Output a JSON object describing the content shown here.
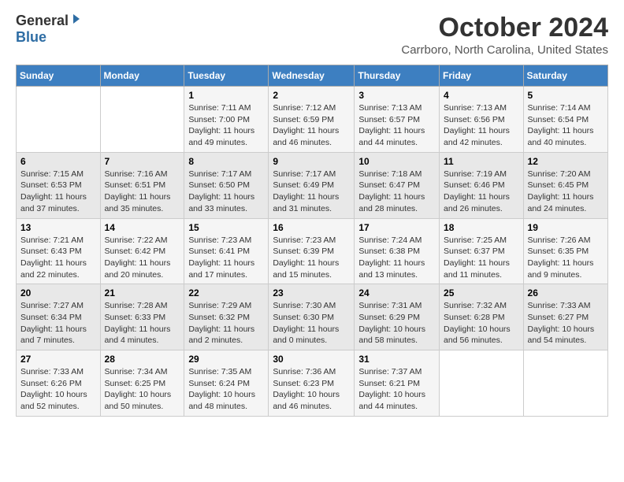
{
  "header": {
    "logo_general": "General",
    "logo_blue": "Blue",
    "main_title": "October 2024",
    "subtitle": "Carrboro, North Carolina, United States"
  },
  "days_of_week": [
    "Sunday",
    "Monday",
    "Tuesday",
    "Wednesday",
    "Thursday",
    "Friday",
    "Saturday"
  ],
  "weeks": [
    [
      {
        "num": "",
        "sunrise": "",
        "sunset": "",
        "daylight": ""
      },
      {
        "num": "",
        "sunrise": "",
        "sunset": "",
        "daylight": ""
      },
      {
        "num": "1",
        "sunrise": "Sunrise: 7:11 AM",
        "sunset": "Sunset: 7:00 PM",
        "daylight": "Daylight: 11 hours and 49 minutes."
      },
      {
        "num": "2",
        "sunrise": "Sunrise: 7:12 AM",
        "sunset": "Sunset: 6:59 PM",
        "daylight": "Daylight: 11 hours and 46 minutes."
      },
      {
        "num": "3",
        "sunrise": "Sunrise: 7:13 AM",
        "sunset": "Sunset: 6:57 PM",
        "daylight": "Daylight: 11 hours and 44 minutes."
      },
      {
        "num": "4",
        "sunrise": "Sunrise: 7:13 AM",
        "sunset": "Sunset: 6:56 PM",
        "daylight": "Daylight: 11 hours and 42 minutes."
      },
      {
        "num": "5",
        "sunrise": "Sunrise: 7:14 AM",
        "sunset": "Sunset: 6:54 PM",
        "daylight": "Daylight: 11 hours and 40 minutes."
      }
    ],
    [
      {
        "num": "6",
        "sunrise": "Sunrise: 7:15 AM",
        "sunset": "Sunset: 6:53 PM",
        "daylight": "Daylight: 11 hours and 37 minutes."
      },
      {
        "num": "7",
        "sunrise": "Sunrise: 7:16 AM",
        "sunset": "Sunset: 6:51 PM",
        "daylight": "Daylight: 11 hours and 35 minutes."
      },
      {
        "num": "8",
        "sunrise": "Sunrise: 7:17 AM",
        "sunset": "Sunset: 6:50 PM",
        "daylight": "Daylight: 11 hours and 33 minutes."
      },
      {
        "num": "9",
        "sunrise": "Sunrise: 7:17 AM",
        "sunset": "Sunset: 6:49 PM",
        "daylight": "Daylight: 11 hours and 31 minutes."
      },
      {
        "num": "10",
        "sunrise": "Sunrise: 7:18 AM",
        "sunset": "Sunset: 6:47 PM",
        "daylight": "Daylight: 11 hours and 28 minutes."
      },
      {
        "num": "11",
        "sunrise": "Sunrise: 7:19 AM",
        "sunset": "Sunset: 6:46 PM",
        "daylight": "Daylight: 11 hours and 26 minutes."
      },
      {
        "num": "12",
        "sunrise": "Sunrise: 7:20 AM",
        "sunset": "Sunset: 6:45 PM",
        "daylight": "Daylight: 11 hours and 24 minutes."
      }
    ],
    [
      {
        "num": "13",
        "sunrise": "Sunrise: 7:21 AM",
        "sunset": "Sunset: 6:43 PM",
        "daylight": "Daylight: 11 hours and 22 minutes."
      },
      {
        "num": "14",
        "sunrise": "Sunrise: 7:22 AM",
        "sunset": "Sunset: 6:42 PM",
        "daylight": "Daylight: 11 hours and 20 minutes."
      },
      {
        "num": "15",
        "sunrise": "Sunrise: 7:23 AM",
        "sunset": "Sunset: 6:41 PM",
        "daylight": "Daylight: 11 hours and 17 minutes."
      },
      {
        "num": "16",
        "sunrise": "Sunrise: 7:23 AM",
        "sunset": "Sunset: 6:39 PM",
        "daylight": "Daylight: 11 hours and 15 minutes."
      },
      {
        "num": "17",
        "sunrise": "Sunrise: 7:24 AM",
        "sunset": "Sunset: 6:38 PM",
        "daylight": "Daylight: 11 hours and 13 minutes."
      },
      {
        "num": "18",
        "sunrise": "Sunrise: 7:25 AM",
        "sunset": "Sunset: 6:37 PM",
        "daylight": "Daylight: 11 hours and 11 minutes."
      },
      {
        "num": "19",
        "sunrise": "Sunrise: 7:26 AM",
        "sunset": "Sunset: 6:35 PM",
        "daylight": "Daylight: 11 hours and 9 minutes."
      }
    ],
    [
      {
        "num": "20",
        "sunrise": "Sunrise: 7:27 AM",
        "sunset": "Sunset: 6:34 PM",
        "daylight": "Daylight: 11 hours and 7 minutes."
      },
      {
        "num": "21",
        "sunrise": "Sunrise: 7:28 AM",
        "sunset": "Sunset: 6:33 PM",
        "daylight": "Daylight: 11 hours and 4 minutes."
      },
      {
        "num": "22",
        "sunrise": "Sunrise: 7:29 AM",
        "sunset": "Sunset: 6:32 PM",
        "daylight": "Daylight: 11 hours and 2 minutes."
      },
      {
        "num": "23",
        "sunrise": "Sunrise: 7:30 AM",
        "sunset": "Sunset: 6:30 PM",
        "daylight": "Daylight: 11 hours and 0 minutes."
      },
      {
        "num": "24",
        "sunrise": "Sunrise: 7:31 AM",
        "sunset": "Sunset: 6:29 PM",
        "daylight": "Daylight: 10 hours and 58 minutes."
      },
      {
        "num": "25",
        "sunrise": "Sunrise: 7:32 AM",
        "sunset": "Sunset: 6:28 PM",
        "daylight": "Daylight: 10 hours and 56 minutes."
      },
      {
        "num": "26",
        "sunrise": "Sunrise: 7:33 AM",
        "sunset": "Sunset: 6:27 PM",
        "daylight": "Daylight: 10 hours and 54 minutes."
      }
    ],
    [
      {
        "num": "27",
        "sunrise": "Sunrise: 7:33 AM",
        "sunset": "Sunset: 6:26 PM",
        "daylight": "Daylight: 10 hours and 52 minutes."
      },
      {
        "num": "28",
        "sunrise": "Sunrise: 7:34 AM",
        "sunset": "Sunset: 6:25 PM",
        "daylight": "Daylight: 10 hours and 50 minutes."
      },
      {
        "num": "29",
        "sunrise": "Sunrise: 7:35 AM",
        "sunset": "Sunset: 6:24 PM",
        "daylight": "Daylight: 10 hours and 48 minutes."
      },
      {
        "num": "30",
        "sunrise": "Sunrise: 7:36 AM",
        "sunset": "Sunset: 6:23 PM",
        "daylight": "Daylight: 10 hours and 46 minutes."
      },
      {
        "num": "31",
        "sunrise": "Sunrise: 7:37 AM",
        "sunset": "Sunset: 6:21 PM",
        "daylight": "Daylight: 10 hours and 44 minutes."
      },
      {
        "num": "",
        "sunrise": "",
        "sunset": "",
        "daylight": ""
      },
      {
        "num": "",
        "sunrise": "",
        "sunset": "",
        "daylight": ""
      }
    ]
  ]
}
